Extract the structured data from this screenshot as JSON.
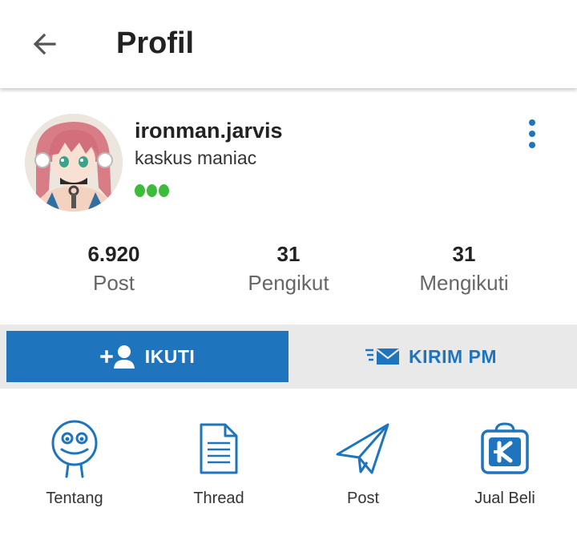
{
  "appbar": {
    "title": "Profil",
    "back_icon": "arrow-left-icon"
  },
  "profile": {
    "username": "ironman.jarvis",
    "user_title": "kaskus maniac",
    "reputation_dots": 3,
    "reputation_color": "#3dbb3a",
    "more_icon": "more-vertical-icon"
  },
  "stats": [
    {
      "value": "6.920",
      "label": "Post"
    },
    {
      "value": "31",
      "label": "Pengikut"
    },
    {
      "value": "31",
      "label": "Mengikuti"
    }
  ],
  "actions": {
    "follow_label": "IKUTI",
    "follow_icon": "add-user-icon",
    "pm_label": "KIRIM PM",
    "pm_icon": "mail-send-icon"
  },
  "menu": [
    {
      "label": "Tentang",
      "icon": "smiley-face-icon"
    },
    {
      "label": "Thread",
      "icon": "document-icon"
    },
    {
      "label": "Post",
      "icon": "paper-plane-icon"
    },
    {
      "label": "Jual Beli",
      "icon": "shopping-bag-k-icon"
    }
  ],
  "colors": {
    "accent": "#1e74bd",
    "action_bar_bg": "#e9e9e9"
  }
}
